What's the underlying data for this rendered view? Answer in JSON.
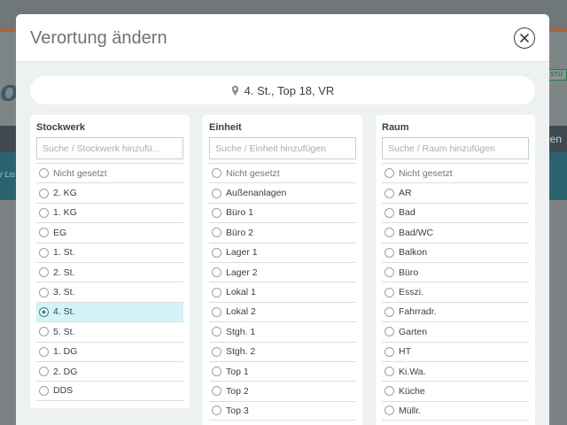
{
  "background": {
    "brand_fragment": "og",
    "tag_fragment": "STÜ",
    "bar_fragment": "en",
    "list_fragment": "r Lis"
  },
  "modal": {
    "title": "Verortung ändern",
    "location": "4. St., Top 18, VR"
  },
  "columns": [
    {
      "title": "Stockwerk",
      "placeholder": "Suche / Stockwerk hinzufü...",
      "items": [
        {
          "label": "Nicht gesetzt",
          "muted": true
        },
        {
          "label": "2. KG"
        },
        {
          "label": "1. KG"
        },
        {
          "label": "EG"
        },
        {
          "label": "1. St."
        },
        {
          "label": "2. St."
        },
        {
          "label": "3. St."
        },
        {
          "label": "4. St.",
          "selected": true
        },
        {
          "label": "5. St."
        },
        {
          "label": "1. DG"
        },
        {
          "label": "2. DG"
        },
        {
          "label": "DDS"
        }
      ]
    },
    {
      "title": "Einheit",
      "placeholder": "Suche / Einheit hinzufügen",
      "items": [
        {
          "label": "Nicht gesetzt",
          "muted": true
        },
        {
          "label": "Außenanlagen"
        },
        {
          "label": "Büro 1"
        },
        {
          "label": "Büro 2"
        },
        {
          "label": "Lager 1"
        },
        {
          "label": "Lager 2"
        },
        {
          "label": "Lokal 1"
        },
        {
          "label": "Lokal 2"
        },
        {
          "label": "Stgh. 1"
        },
        {
          "label": "Stgh. 2"
        },
        {
          "label": "Top 1"
        },
        {
          "label": "Top 2"
        },
        {
          "label": "Top 3"
        }
      ]
    },
    {
      "title": "Raum",
      "placeholder": "Suche / Raum hinzufügen",
      "items": [
        {
          "label": "Nicht gesetzt",
          "muted": true
        },
        {
          "label": "AR"
        },
        {
          "label": "Bad"
        },
        {
          "label": "Bad/WC"
        },
        {
          "label": "Balkon"
        },
        {
          "label": "Büro"
        },
        {
          "label": "Esszi."
        },
        {
          "label": "Fahrradr."
        },
        {
          "label": "Garten"
        },
        {
          "label": "HT"
        },
        {
          "label": "Ki.Wa."
        },
        {
          "label": "Küche"
        },
        {
          "label": "Müllr."
        }
      ]
    }
  ],
  "colors": {
    "accent": "#2a8a9a",
    "selected_row": "#d3f3f8"
  },
  "icons": {
    "close": "close-circle-icon",
    "location": "map-pin-icon"
  }
}
